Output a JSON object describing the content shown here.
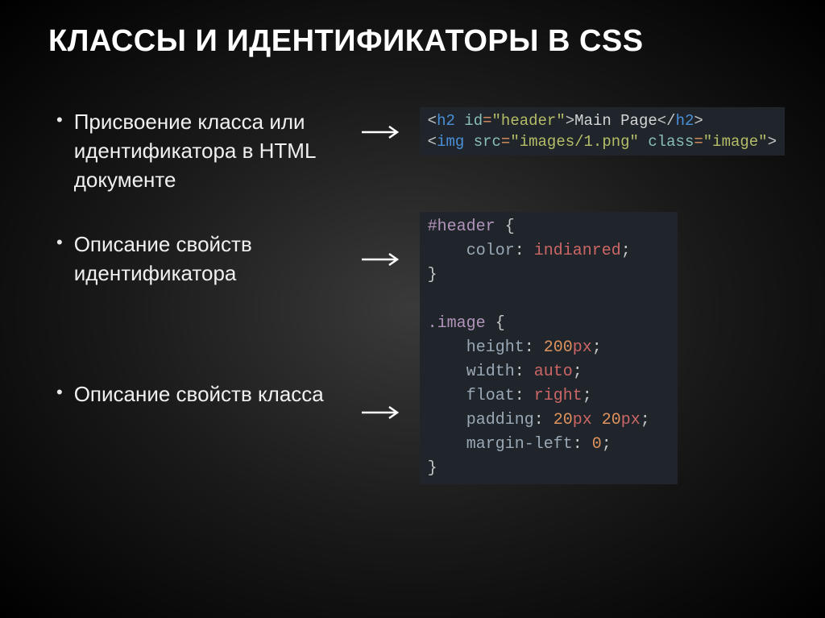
{
  "title": "КЛАССЫ И ИДЕНТИФИКАТОРЫ В CSS",
  "bullets": {
    "b1": "Присвоение класса или идентификатора в HTML документе",
    "b2": "Описание свойств идентификатора",
    "b3": "Описание свойств класса"
  },
  "code1": {
    "l1": {
      "a": "<",
      "b": "h2 ",
      "c": "id",
      "d": "=",
      "e": "\"header\"",
      "f": ">",
      "g": "Main Page",
      "h": "</",
      "i": "h2",
      "j": ">"
    },
    "l2": {
      "a": "<",
      "b": "img ",
      "c": "src",
      "d": "=",
      "e": "\"images/1.png\" ",
      "f": "class",
      "g": "=",
      "h": "\"image\"",
      "i": ">"
    }
  },
  "code2": {
    "l1a": "#header ",
    "l1b": "{",
    "l2a": "    ",
    "l2b": "color",
    "l2c": ": ",
    "l2d": "indianred",
    "l2e": ";",
    "l3": "}",
    "blank": "",
    "l5a": ".image ",
    "l5b": "{",
    "l6a": "    ",
    "l6b": "height",
    "l6c": ": ",
    "l6d": "200",
    "l6e": "px",
    "l6f": ";",
    "l7a": "    ",
    "l7b": "width",
    "l7c": ": ",
    "l7d": "auto",
    "l7e": ";",
    "l8a": "    ",
    "l8b": "float",
    "l8c": ": ",
    "l8d": "right",
    "l8e": ";",
    "l9a": "    ",
    "l9b": "padding",
    "l9c": ": ",
    "l9d": "20",
    "l9e": "px ",
    "l9f": "20",
    "l9g": "px",
    "l9h": ";",
    "l10a": "    ",
    "l10b": "margin-left",
    "l10c": ": ",
    "l10d": "0",
    "l10e": ";",
    "l11": "}"
  }
}
